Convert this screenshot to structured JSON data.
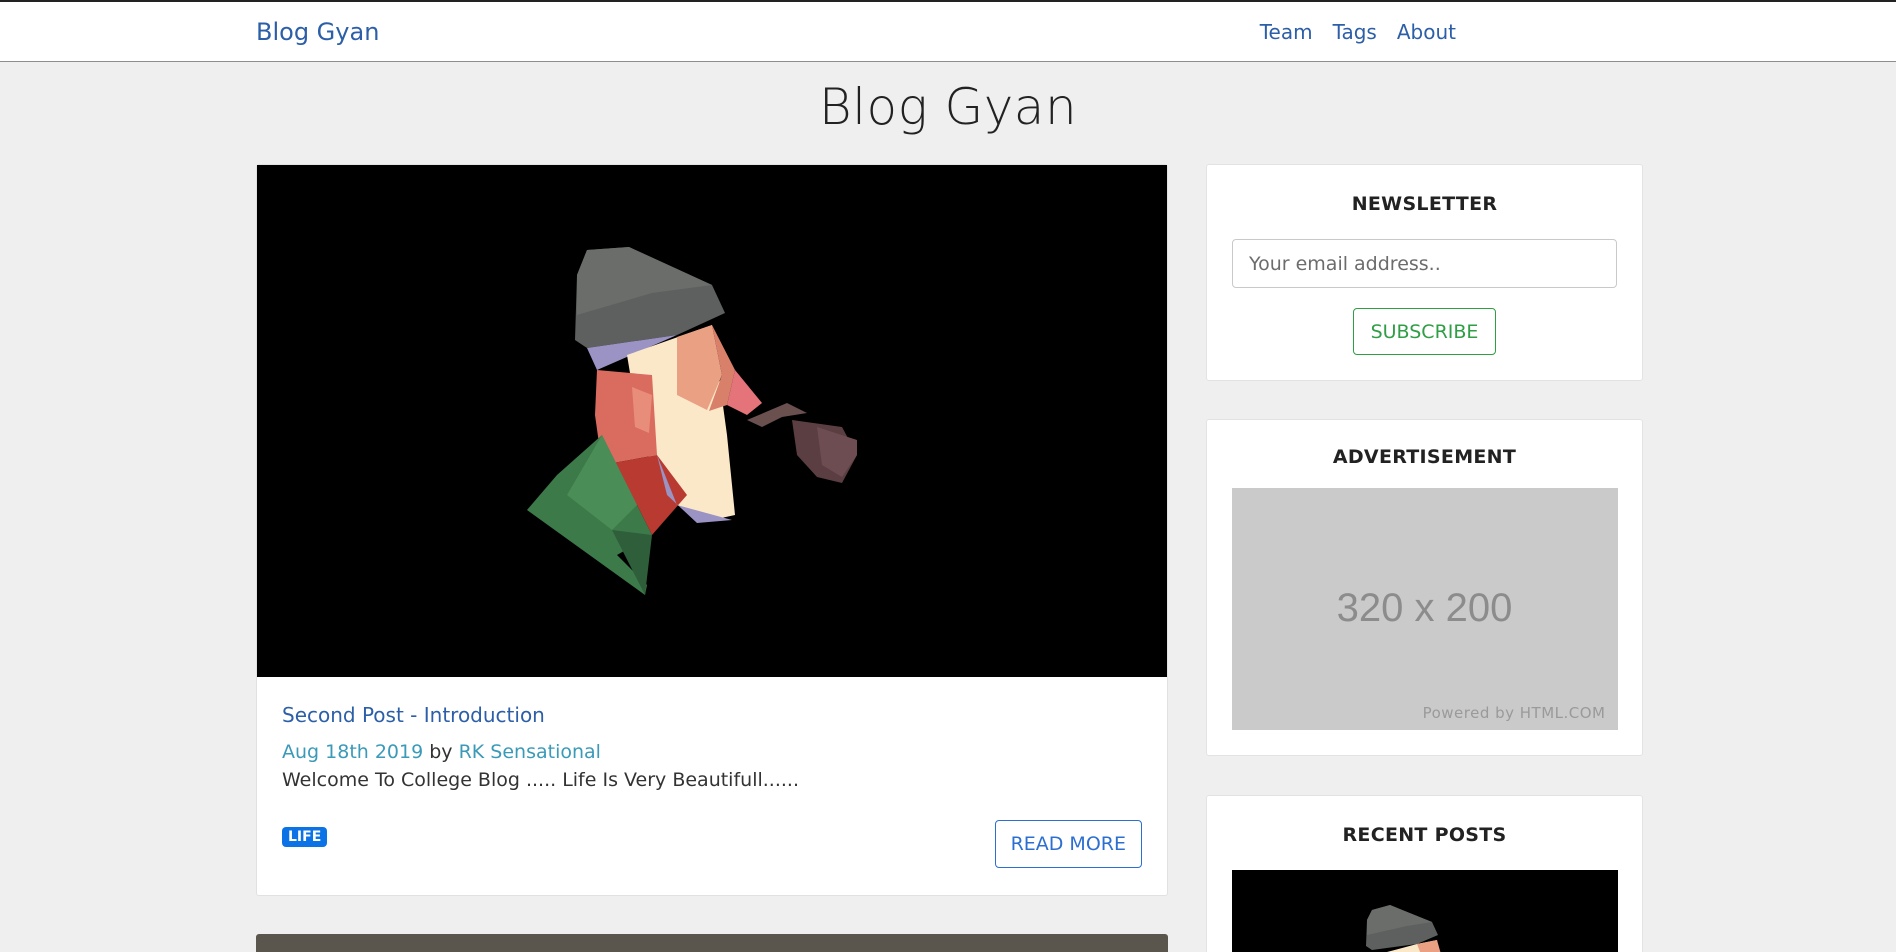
{
  "navbar": {
    "brand": "Blog Gyan",
    "links": [
      {
        "label": "Team"
      },
      {
        "label": "Tags"
      },
      {
        "label": "About"
      }
    ]
  },
  "page": {
    "title": "Blog Gyan"
  },
  "post": {
    "title": "Second Post - Introduction",
    "date": "Aug 18th 2019",
    "by": "by",
    "author": "RK Sensational",
    "excerpt": "Welcome To College Blog ..... Life Is Very Beautifull......",
    "tag": "LIFE",
    "read_more": "READ MORE"
  },
  "sidebar": {
    "newsletter": {
      "title": "NEWSLETTER",
      "placeholder": "Your email address..",
      "button": "SUBSCRIBE"
    },
    "advertisement": {
      "title": "ADVERTISEMENT",
      "size_text": "320 x 200",
      "powered_text": "Powered by HTML.COM"
    },
    "recent_posts": {
      "title": "RECENT POSTS"
    }
  },
  "colors": {
    "link": "#2c5fa8",
    "meta": "#3a9ab8",
    "badge": "#0b73e6",
    "subscribe": "#2f9e45"
  }
}
